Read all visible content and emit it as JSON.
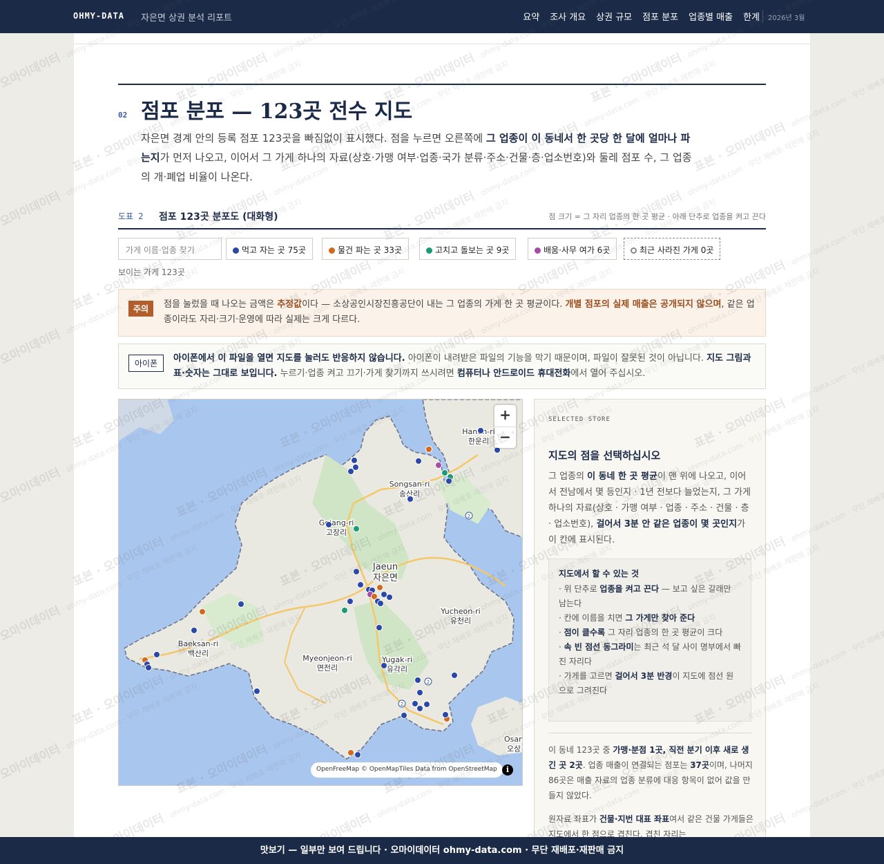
{
  "topbar": {
    "brand": "OHMY-DATA",
    "subtitle": "자은면 상권 분석 리포트",
    "nav": [
      "요약",
      "조사 개요",
      "상권 규모",
      "점포 분포",
      "업종별 매출",
      "한계"
    ],
    "date": "2026년 3월"
  },
  "section": {
    "number": "02",
    "title": "점포 분포 — 123곳 전수 지도",
    "intro_1": "자은면 경계 안의 등록 점포 123곳을 빠짐없이 표시했다. 점을 누르면 오른쪽에 ",
    "intro_bold": "그 업종이 이 동네서 한 곳당 한 달에 얼마나 파는지",
    "intro_2": "가 먼저 나오고, 이어서 그 가게 하나의 자료(상호·가맹 여부·업종·국가 분류·주소·건물·층·업소번호)와 둘레 점포 수, 그 업종의 개·폐업 비율이 나온다."
  },
  "figure": {
    "label": "도표 2",
    "title": "점포 123곳 분포도 (대화형)",
    "note": "점 크기 = 그 자리 업종의 한 곳 평균 · 아래 단추로 업종을 켜고 끈다"
  },
  "filters": {
    "search_placeholder": "가게 이름·업종 찾기",
    "chips": [
      {
        "label": "먹고 자는 곳 75곳",
        "color": "#2b47a8"
      },
      {
        "label": "물건 파는 곳 33곳",
        "color": "#d2691e"
      },
      {
        "label": "고치고 돌보는 곳 9곳",
        "color": "#1a9a76"
      },
      {
        "label": "배움·사무 여가 6곳",
        "color": "#a64ca6"
      },
      {
        "label": "최근 사라진 가게 0곳",
        "color": "#888888"
      }
    ],
    "visible_count": "보이는 가게 123곳"
  },
  "warning": {
    "tag": "주의",
    "t1": "점을 눌렀을 때 나오는 금액은 ",
    "b1": "추정값",
    "t2": "이다 — 소상공인시장진흥공단이 내는 그 업종의 가게 한 곳 평균이다. ",
    "b2": "개별 점포의 실제 매출은 공개되지 않으며",
    "t3": ", 같은 업종이라도 자리·크기·운영에 따라 실제는 크게 다르다."
  },
  "iphone": {
    "tag": "아이폰",
    "b1": "아이폰에서 이 파일을 열면 지도를 눌러도 반응하지 않습니다.",
    "t1": " 아이폰이 내려받은 파일의 기능을 막기 때문이며, 파일이 잘못된 것이 아닙니다. ",
    "b2": "지도 그림과 표·숫자는 그대로 보입니다.",
    "t2": " 누르기·업종 켜고 끄기·가게 찾기까지 쓰시려면 ",
    "b3": "컴퓨터나 안드로이드 휴대전화",
    "t3": "에서 열어 주십시오."
  },
  "map": {
    "zoom_in": "+",
    "zoom_out": "−",
    "attribution": "OpenFreeMap © OpenMapTiles Data from OpenStreetMap",
    "info": "i",
    "places": [
      {
        "en": "Hanun-ri",
        "ko": "한운리"
      },
      {
        "en": "Songsan-ri",
        "ko": "송산리"
      },
      {
        "en": "Gojang-ri",
        "ko": "고장리"
      },
      {
        "en": "Jaeun",
        "ko": "자은면"
      },
      {
        "en": "Yucheon-ri",
        "ko": "유천리"
      },
      {
        "en": "Baeksan-ri",
        "ko": "백산리"
      },
      {
        "en": "Myeonjeon-ri",
        "ko": "면전리"
      },
      {
        "en": "Yugak-ri",
        "ko": "유각리"
      },
      {
        "en": "Osan",
        "ko": "오상"
      }
    ],
    "road_badge": "2"
  },
  "panel": {
    "kicker": "SELECTED STORE",
    "title": "지도의 점을 선택하십시오",
    "d1": "그 업종의 ",
    "d1b": "이 동네 한 곳 평균",
    "d2": "이 맨 위에 나오고, 이어서 전남에서 몇 등인지 · 1년 전보다 늘었는지, 그 가게 하나의 자료(상호 · 가맹 여부 · 업종 · 주소 · 건물 · 층 · 업소번호), ",
    "d2b": "걸어서 3분 안 같은 업종이 몇 곳인지",
    "d3": "가 이 칸에 표시된다.",
    "box_title": "지도에서 할 수 있는 것",
    "box_items": [
      {
        "pre": "· 위 단추로 ",
        "b": "업종을 켜고 끈다",
        "post": " — 보고 싶은 갈래만 남는다"
      },
      {
        "pre": "· 칸에 이름을 치면 ",
        "b": "그 가게만 찾아 준다",
        "post": ""
      },
      {
        "pre": "· ",
        "b": "점이 클수록",
        "post": " 그 자리 업종의 한 곳 평균이 크다"
      },
      {
        "pre": "· ",
        "b": "속 빈 점선 동그라미",
        "post": "는 최근 석 달 사이 명부에서 빠진 자리다"
      },
      {
        "pre": "· 가게를 고르면 ",
        "b": "걸어서 3분 반경",
        "post": "이 지도에 점선 원으로 그려진다"
      }
    ],
    "s1": "이 동네 123곳 중 ",
    "s1b": "가맹·분점 1곳, 직전 분기 이후 새로 생긴 곳 2곳",
    "s2": ". 업종 매출이 연결되는 점포는 ",
    "s2b": "37곳",
    "s3": "이며, 나머지 86곳은 매출 자료의 업종 분류에 대응 항목이 없어 값을 만들지 않았다.",
    "n1": "원자료 좌표가 ",
    "n1b": "건물·지번 대표 좌표",
    "n2": "여서 같은 건물 가게들은 지도에서 한 점으로 겹친다. 겹친 자리는"
  },
  "footer": "맛보기 — 일부만 보여 드립니다 · 오마이데이터 ohmy-data.com · 무단 재배포·재판매 금지",
  "watermark": {
    "text": "표본 · 오마이데이터",
    "sub": "ohmy-data.com · 무단 재배포·재판매 금지"
  },
  "colors": {
    "navy": "#1b2a47",
    "eat": "#2b47a8",
    "shop": "#d2691e",
    "care": "#1a9a76",
    "office": "#a64ca6"
  }
}
